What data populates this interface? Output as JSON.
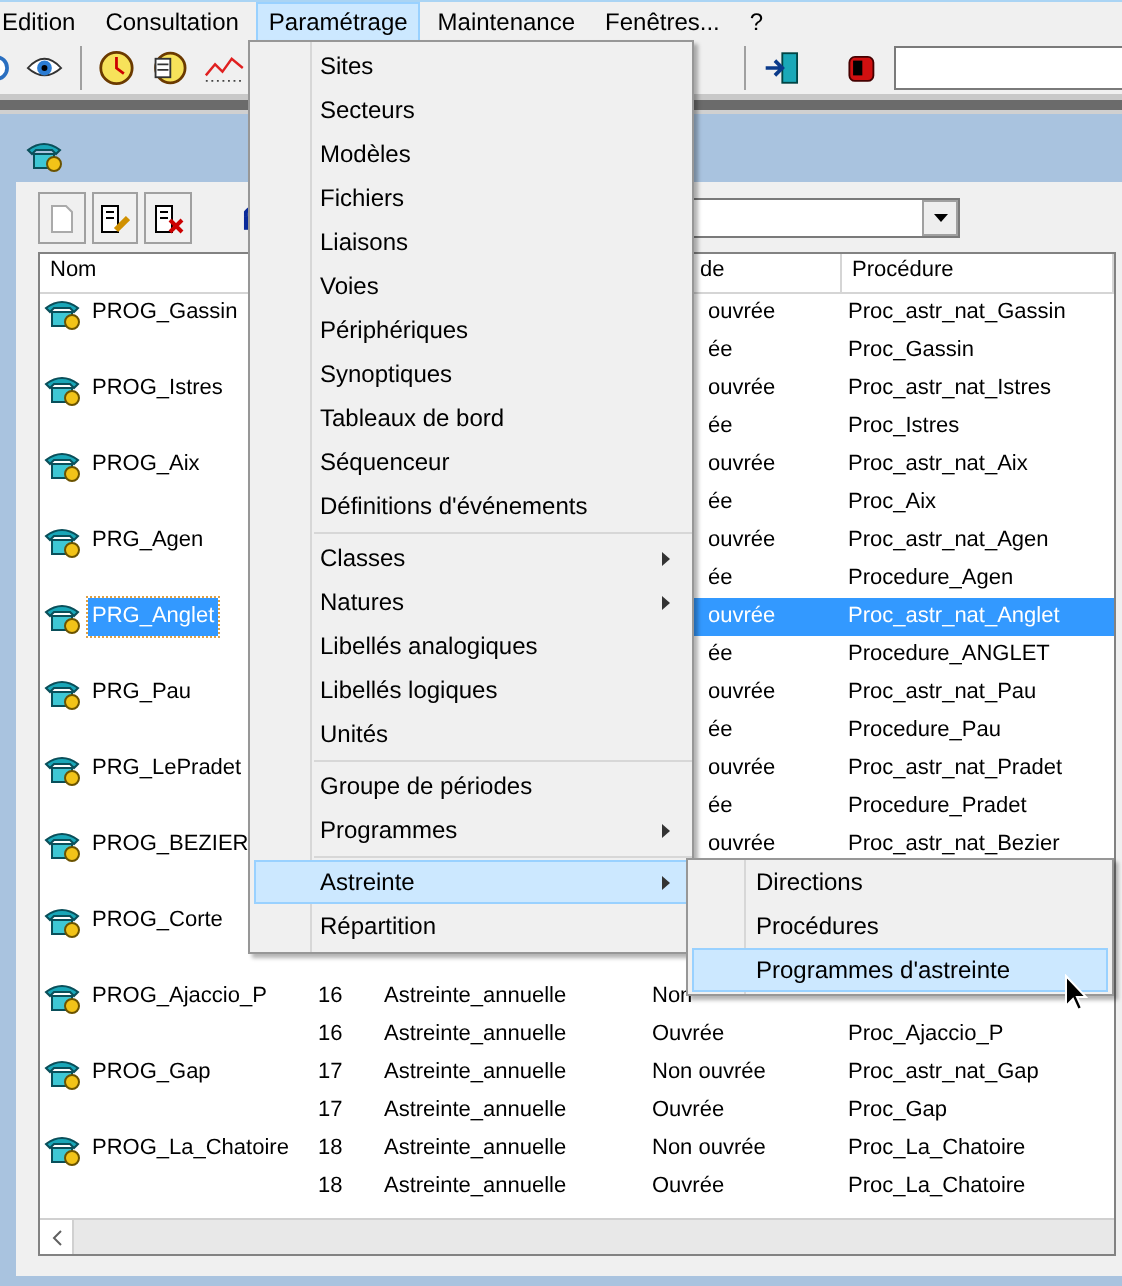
{
  "menubar": [
    {
      "label": "Edition",
      "selected": false
    },
    {
      "label": "Consultation",
      "selected": false
    },
    {
      "label": "Paramétrage",
      "selected": true
    },
    {
      "label": "Maintenance",
      "selected": false
    },
    {
      "label": "Fenêtres...",
      "selected": false
    },
    {
      "label": "?",
      "selected": false
    }
  ],
  "list": {
    "columns": [
      "Nom",
      "de",
      "Procédure"
    ],
    "rows": [
      {
        "name": "PROG_Gassin",
        "mode": "ouvrée",
        "procedure": "Proc_astr_nat_Gassin",
        "selected": false
      },
      {
        "mode": "ée",
        "procedure": "Proc_Gassin",
        "selected": false
      },
      {
        "name": "PROG_Istres",
        "mode": "ouvrée",
        "procedure": "Proc_astr_nat_Istres",
        "selected": false
      },
      {
        "mode": "ée",
        "procedure": "Proc_Istres",
        "selected": false
      },
      {
        "name": "PROG_Aix",
        "mode": "ouvrée",
        "procedure": "Proc_astr_nat_Aix",
        "selected": false
      },
      {
        "mode": "ée",
        "procedure": "Proc_Aix",
        "selected": false
      },
      {
        "name": "PRG_Agen",
        "mode": "ouvrée",
        "procedure": "Proc_astr_nat_Agen",
        "selected": false
      },
      {
        "mode": "ée",
        "procedure": "Procedure_Agen",
        "selected": false
      },
      {
        "name": "PRG_Anglet",
        "mode": "ouvrée",
        "procedure": "Proc_astr_nat_Anglet",
        "selected": true
      },
      {
        "mode": "ée",
        "procedure": "Procedure_ANGLET",
        "selected": false
      },
      {
        "name": "PRG_Pau",
        "mode": "ouvrée",
        "procedure": "Proc_astr_nat_Pau",
        "selected": false
      },
      {
        "mode": "ée",
        "procedure": "Procedure_Pau",
        "selected": false
      },
      {
        "name": "PRG_LePradet",
        "mode": "ouvrée",
        "procedure": "Proc_astr_nat_Pradet",
        "selected": false
      },
      {
        "mode": "ée",
        "procedure": "Procedure_Pradet",
        "selected": false
      },
      {
        "name": "PROG_BEZIER",
        "mode": "ouvrée",
        "procedure": "Proc_astr_nat_Bezier",
        "selected": false
      },
      {
        "selected": false
      },
      {
        "name": "PROG_Corte",
        "selected": false
      },
      {
        "selected": false
      },
      {
        "name": "PROG_Ajaccio_P",
        "number": "16",
        "type": "Astreinte_annuelle",
        "mode": "Non",
        "selected": false
      },
      {
        "number": "16",
        "type": "Astreinte_annuelle",
        "mode": "Ouvrée",
        "procedure": "Proc_Ajaccio_P",
        "selected": false
      },
      {
        "name": "PROG_Gap",
        "number": "17",
        "type": "Astreinte_annuelle",
        "mode": "Non ouvrée",
        "procedure": "Proc_astr_nat_Gap",
        "selected": false
      },
      {
        "number": "17",
        "type": "Astreinte_annuelle",
        "mode": "Ouvrée",
        "procedure": "Proc_Gap",
        "selected": false
      },
      {
        "name": "PROG_La_Chatoire",
        "number": "18",
        "type": "Astreinte_annuelle",
        "mode": "Non ouvrée",
        "procedure": "Proc_La_Chatoire",
        "selected": false
      },
      {
        "number": "18",
        "type": "Astreinte_annuelle",
        "mode": "Ouvrée",
        "procedure": "Proc_La_Chatoire",
        "selected": false
      }
    ]
  },
  "menu": {
    "items": [
      {
        "kind": "item",
        "label": "Sites",
        "submenu": false,
        "selected": false
      },
      {
        "kind": "item",
        "label": "Secteurs",
        "submenu": false,
        "selected": false
      },
      {
        "kind": "item",
        "label": "Modèles",
        "submenu": false,
        "selected": false
      },
      {
        "kind": "item",
        "label": "Fichiers",
        "submenu": false,
        "selected": false
      },
      {
        "kind": "item",
        "label": "Liaisons",
        "submenu": false,
        "selected": false
      },
      {
        "kind": "item",
        "label": "Voies",
        "submenu": false,
        "selected": false
      },
      {
        "kind": "item",
        "label": "Périphériques",
        "submenu": false,
        "selected": false
      },
      {
        "kind": "item",
        "label": "Synoptiques",
        "submenu": false,
        "selected": false
      },
      {
        "kind": "item",
        "label": "Tableaux de bord",
        "submenu": false,
        "selected": false
      },
      {
        "kind": "item",
        "label": "Séquenceur",
        "submenu": false,
        "selected": false
      },
      {
        "kind": "item",
        "label": "Définitions d'événements",
        "submenu": false,
        "selected": false
      },
      {
        "kind": "separator"
      },
      {
        "kind": "item",
        "label": "Classes",
        "submenu": true,
        "selected": false
      },
      {
        "kind": "item",
        "label": "Natures",
        "submenu": true,
        "selected": false
      },
      {
        "kind": "item",
        "label": "Libellés analogiques",
        "submenu": false,
        "selected": false
      },
      {
        "kind": "item",
        "label": "Libellés logiques",
        "submenu": false,
        "selected": false
      },
      {
        "kind": "item",
        "label": "Unités",
        "submenu": false,
        "selected": false
      },
      {
        "kind": "separator"
      },
      {
        "kind": "item",
        "label": "Groupe de périodes",
        "submenu": false,
        "selected": false
      },
      {
        "kind": "item",
        "label": "Programmes",
        "submenu": true,
        "selected": false
      },
      {
        "kind": "separator"
      },
      {
        "kind": "item",
        "label": "Astreinte",
        "submenu": true,
        "selected": true
      },
      {
        "kind": "item",
        "label": "Répartition",
        "submenu": false,
        "selected": false
      }
    ]
  },
  "submenu": {
    "items": [
      {
        "kind": "item",
        "label": "Directions",
        "submenu": false,
        "selected": false
      },
      {
        "kind": "item",
        "label": "Procédures",
        "submenu": false,
        "selected": false
      },
      {
        "kind": "item",
        "label": "Programmes d'astreinte",
        "submenu": false,
        "selected": true
      }
    ]
  }
}
